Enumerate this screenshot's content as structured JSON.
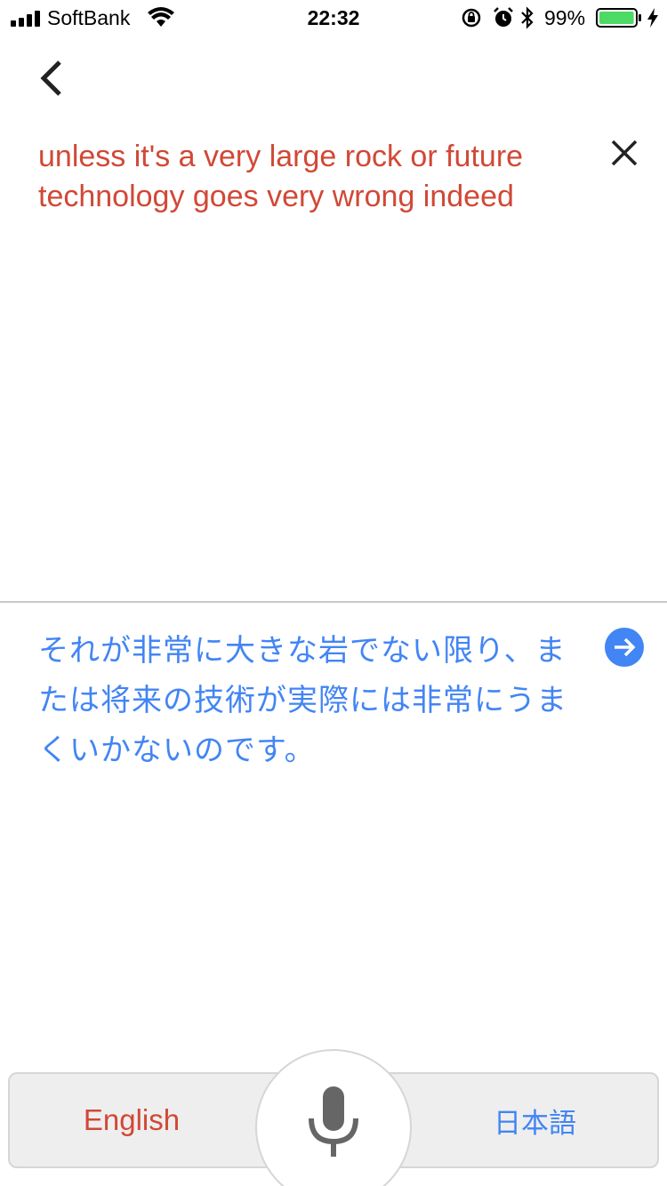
{
  "status_bar": {
    "carrier": "SoftBank",
    "time": "22:32",
    "battery_percent": "99%",
    "battery_level": 0.99,
    "icons": [
      "signal-icon",
      "wifi-icon",
      "orientation-lock-icon",
      "alarm-icon",
      "bluetooth-icon",
      "battery-icon",
      "charging-icon"
    ]
  },
  "header": {
    "back_icon": "chevron-left-icon",
    "close_icon": "close-icon"
  },
  "source": {
    "text": "unless it's a very large rock or future technology goes very wrong indeed",
    "color": "#d14836"
  },
  "translation": {
    "text": "それが非常に大きな岩でない限り、または将来の技術が実際には非常にうまくいかないのです。",
    "color": "#4285f4",
    "action_icon": "arrow-right-icon"
  },
  "language_bar": {
    "source_language": "English",
    "target_language": "日本語",
    "mic_icon": "microphone-icon"
  }
}
